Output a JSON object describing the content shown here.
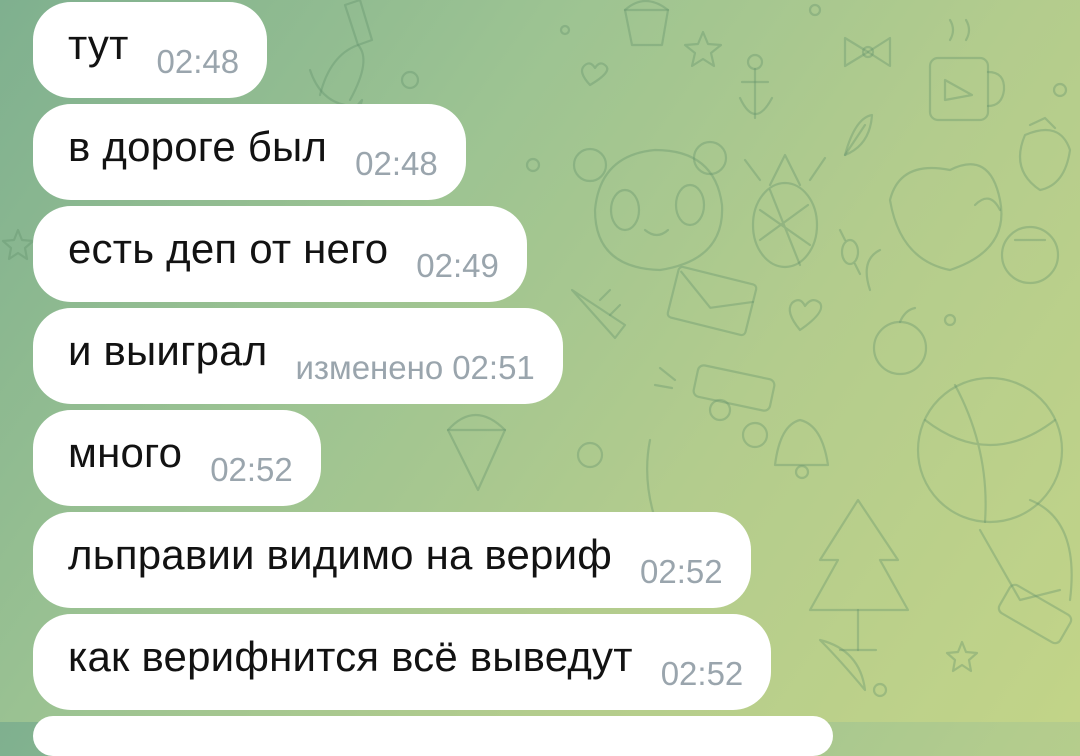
{
  "messages": [
    {
      "text": "тут",
      "time": "02:48",
      "edited": ""
    },
    {
      "text": "в дороге был",
      "time": "02:48",
      "edited": ""
    },
    {
      "text": "есть деп от него",
      "time": "02:49",
      "edited": ""
    },
    {
      "text": "и выиграл",
      "time": "02:51",
      "edited": "изменено"
    },
    {
      "text": "много",
      "time": "02:52",
      "edited": ""
    },
    {
      "text": "льправии видимо на вериф",
      "time": "02:52",
      "edited": ""
    },
    {
      "text": "как верифнится всё выведут",
      "time": "02:52",
      "edited": ""
    }
  ],
  "colors": {
    "bubble": "#ffffff",
    "text": "#121212",
    "time": "#9aa5ad",
    "wallpaper_start": "#7fb08f",
    "wallpaper_end": "#c2d488"
  },
  "wallpaper_icons": [
    "bottle-icon",
    "banana-icon",
    "bucket-icon",
    "star-icon",
    "bow-icon",
    "anchor-icon",
    "mug-icon",
    "strawberry-icon",
    "leaf-icon",
    "panda-icon",
    "pineapple-icon",
    "cat-icon",
    "envelope-icon",
    "heart-icon",
    "apple-icon",
    "candy-icon",
    "battery-icon",
    "bell-icon",
    "ice-cream-icon",
    "ball-icon",
    "balloon-icon",
    "tree-icon",
    "flashlight-icon",
    "moon-icon",
    "carrot-icon"
  ]
}
